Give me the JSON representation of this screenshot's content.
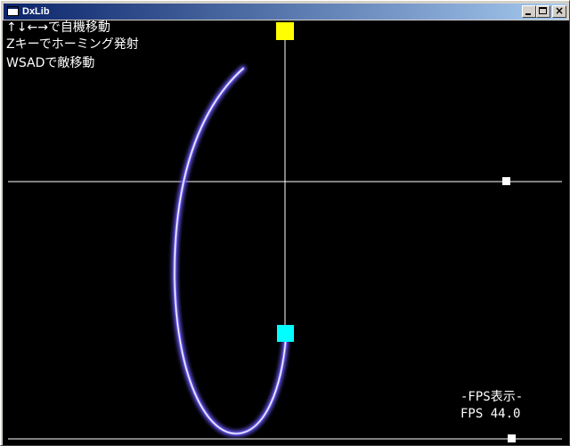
{
  "window": {
    "title": "DxLib"
  },
  "hud": {
    "line1": "↑↓←→で自機移動",
    "line2": "Zキーでホーミング発射",
    "line3": "WSADで敵移動"
  },
  "fps": {
    "title": "-FPS表示-",
    "value": "FPS 44.0"
  },
  "colors": {
    "background": "#000000",
    "crosshair": "#ffffff",
    "enemy": "#ffff00",
    "player": "#00ffff",
    "homing_trail": "#6655ee",
    "homing_core": "#ffffff",
    "marker": "#ffffff"
  },
  "icons": {
    "app": "window-icon",
    "minimize": "minimize-icon",
    "maximize": "maximize-icon",
    "close": "close-icon"
  }
}
